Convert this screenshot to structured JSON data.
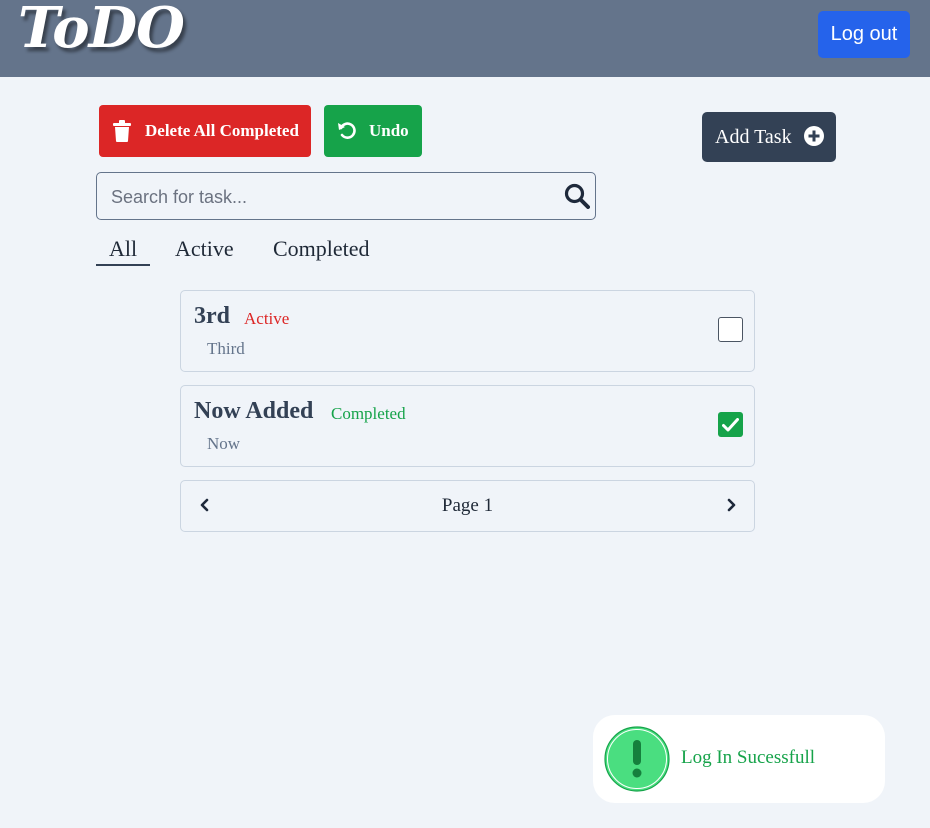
{
  "header": {
    "logo_text": "ToDO",
    "logout_label": "Log out"
  },
  "actions": {
    "delete_completed_label": "Delete All Completed",
    "undo_label": "Undo",
    "add_task_label": "Add Task"
  },
  "search": {
    "placeholder": "Search for task...",
    "value": ""
  },
  "tabs": [
    {
      "label": "All",
      "selected": true
    },
    {
      "label": "Active",
      "selected": false
    },
    {
      "label": "Completed",
      "selected": false
    }
  ],
  "tasks": [
    {
      "title": "3rd",
      "status": "Active",
      "description": "Third",
      "checked": false
    },
    {
      "title": "Now Added",
      "status": "Completed",
      "description": "Now",
      "checked": true
    }
  ],
  "pagination": {
    "label": "Page 1"
  },
  "toast": {
    "message": "Log In Sucessfull"
  },
  "colors": {
    "header_bg": "#64748b",
    "logout_blue": "#2563eb",
    "delete_red": "#dc2626",
    "undo_green": "#16a34a",
    "add_dark": "#334155",
    "active_status": "#dc2626",
    "completed_status": "#16a34a"
  },
  "icons": {
    "delete": "trash-icon",
    "undo": "undo-icon",
    "add": "plus-circle-icon",
    "search": "search-icon",
    "prev": "chevron-left-icon",
    "next": "chevron-right-icon",
    "toast": "exclamation-circle-icon"
  }
}
